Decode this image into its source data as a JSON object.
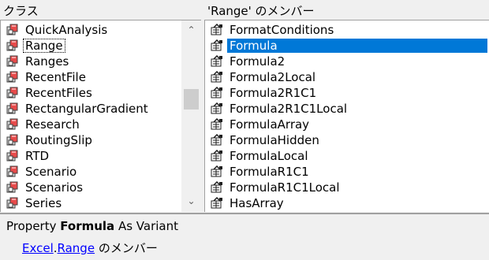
{
  "left_pane": {
    "header": "クラス",
    "items": [
      {
        "label": "QuickAnalysis",
        "selected": false
      },
      {
        "label": "Range",
        "selected": true
      },
      {
        "label": "Ranges",
        "selected": false
      },
      {
        "label": "RecentFile",
        "selected": false
      },
      {
        "label": "RecentFiles",
        "selected": false
      },
      {
        "label": "RectangularGradient",
        "selected": false
      },
      {
        "label": "Research",
        "selected": false
      },
      {
        "label": "RoutingSlip",
        "selected": false
      },
      {
        "label": "RTD",
        "selected": false
      },
      {
        "label": "Scenario",
        "selected": false
      },
      {
        "label": "Scenarios",
        "selected": false
      },
      {
        "label": "Series",
        "selected": false
      }
    ],
    "icon": "class-icon",
    "scrollbar": {
      "up_icon": "chevron-up-icon",
      "down_icon": "chevron-down-icon"
    }
  },
  "right_pane": {
    "header": "'Range' のメンバー",
    "items": [
      {
        "label": "FormatConditions",
        "selected": false
      },
      {
        "label": "Formula",
        "selected": true
      },
      {
        "label": "Formula2",
        "selected": false
      },
      {
        "label": "Formula2Local",
        "selected": false
      },
      {
        "label": "Formula2R1C1",
        "selected": false
      },
      {
        "label": "Formula2R1C1Local",
        "selected": false
      },
      {
        "label": "FormulaArray",
        "selected": false
      },
      {
        "label": "FormulaHidden",
        "selected": false
      },
      {
        "label": "FormulaLocal",
        "selected": false
      },
      {
        "label": "FormulaR1C1",
        "selected": false
      },
      {
        "label": "FormulaR1C1Local",
        "selected": false
      },
      {
        "label": "HasArray",
        "selected": false
      }
    ],
    "icon": "property-icon"
  },
  "details": {
    "prefix": "Property ",
    "member": "Formula",
    "suffix": " As Variant",
    "library_link": "Excel",
    "dot": ".",
    "class_link": "Range",
    "member_of": " のメンバー"
  },
  "colors": {
    "selection": "#0078d7",
    "link": "#0000ff"
  }
}
